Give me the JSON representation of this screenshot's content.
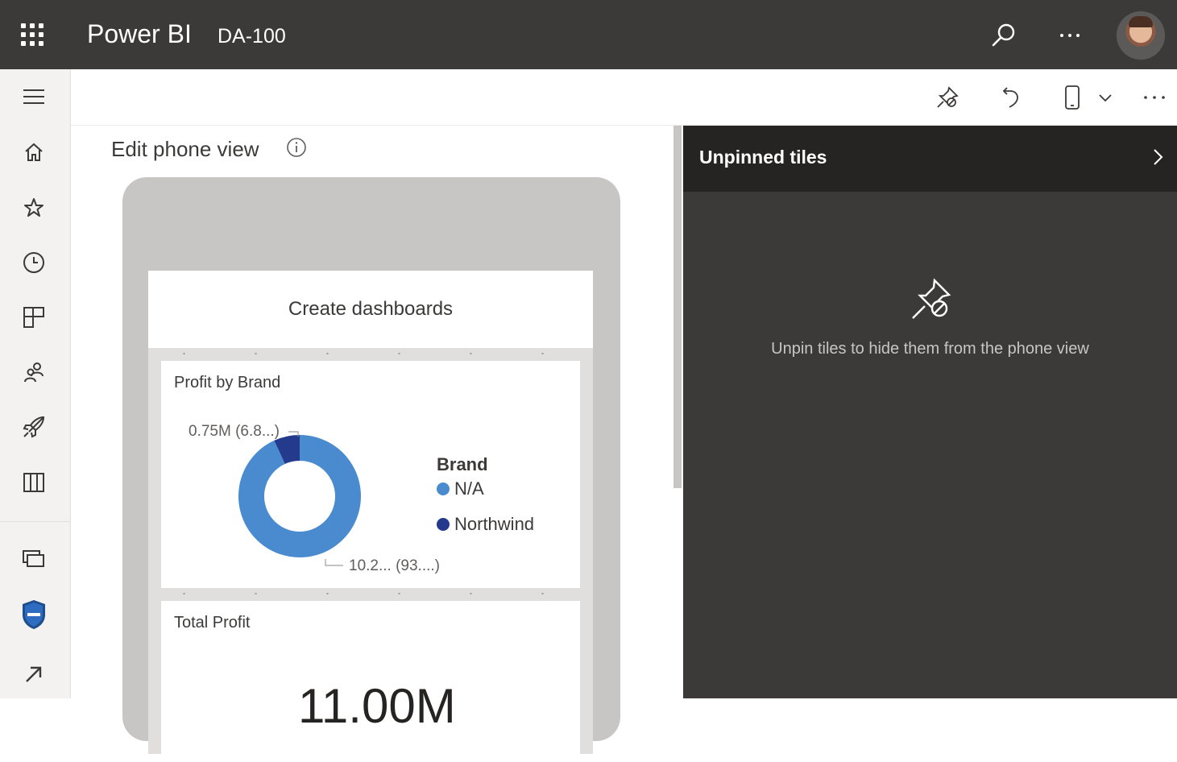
{
  "app": {
    "brand": "Power BI",
    "workspace": "DA-100"
  },
  "topbar": {
    "icons": [
      "waffle-icon",
      "search-icon",
      "more-icon",
      "avatar"
    ]
  },
  "leftnav": {
    "items": [
      "menu-icon",
      "home-icon",
      "favorites-icon",
      "recent-icon",
      "apps-icon",
      "shared-icon",
      "learn-icon",
      "workspaces-icon",
      "my-workspace-icon",
      "security-shield-icon",
      "get-data-icon"
    ]
  },
  "toolbar": {
    "icons": [
      "unpin-icon",
      "undo-icon",
      "phone-view-icon",
      "chevron-down-icon",
      "more-icon"
    ]
  },
  "canvas": {
    "title": "Edit phone view"
  },
  "phone": {
    "title_tile": "Create dashboards",
    "donut_tile": {
      "title": "Profit by Brand",
      "legend_title": "Brand",
      "legend": [
        {
          "label": "N/A",
          "color": "#4a8bd0"
        },
        {
          "label": "Northwind",
          "color": "#243a8c"
        }
      ],
      "label_small": "0.75M (6.8...)",
      "label_large": "10.2... (93....)"
    },
    "total_tile": {
      "title": "Total Profit",
      "value": "11.00M"
    }
  },
  "chart_data": {
    "type": "pie",
    "title": "Profit by Brand",
    "legend_title": "Brand",
    "categories": [
      "N/A",
      "Northwind"
    ],
    "values": [
      10.2,
      0.75
    ],
    "units": "M",
    "colors": [
      "#4a8bd0",
      "#243a8c"
    ],
    "legend_position": "right"
  },
  "pane": {
    "title": "Unpinned tiles",
    "message": "Unpin tiles to hide them from the phone view"
  },
  "colors": {
    "topbar": "#3b3a39",
    "pane": "#3b3a39",
    "pane_header": "#252423",
    "na_series": "#4a8bd0",
    "northwind_series": "#243a8c"
  }
}
